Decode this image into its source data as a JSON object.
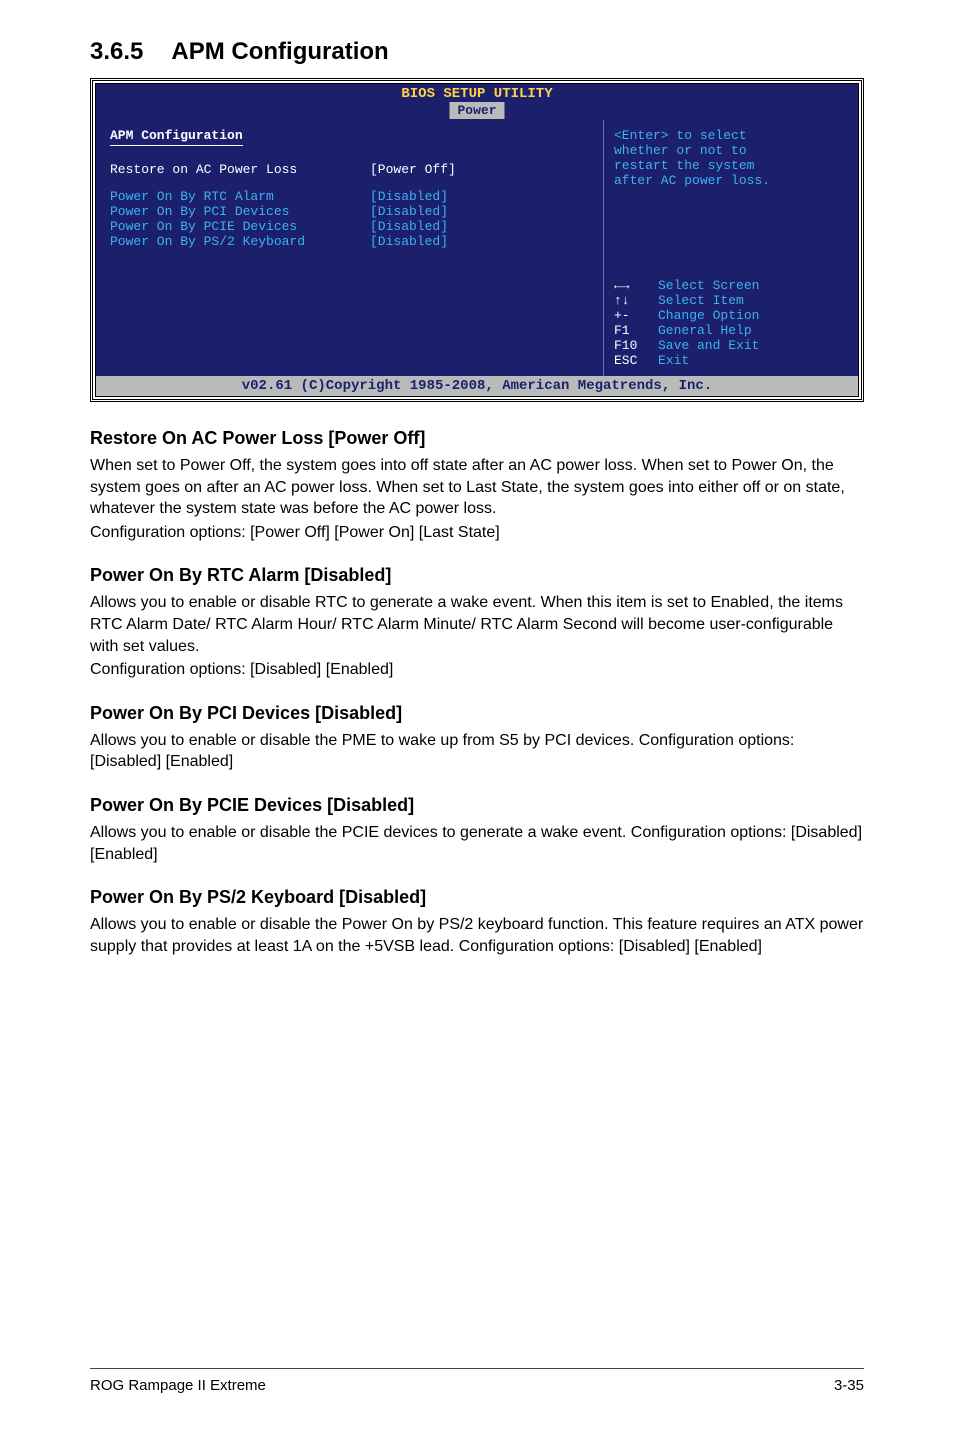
{
  "section": {
    "number": "3.6.5",
    "title": "APM Configuration"
  },
  "bios": {
    "title": "BIOS SETUP UTILITY",
    "tab": "Power",
    "panel_heading": "APM Configuration",
    "items": [
      {
        "label": "Restore on AC Power Loss",
        "value": "[Power Off]"
      },
      {
        "label": "Power On By RTC Alarm",
        "value": "[Disabled]"
      },
      {
        "label": "Power On By PCI Devices",
        "value": "[Disabled]"
      },
      {
        "label": "Power On By PCIE Devices",
        "value": "[Disabled]"
      },
      {
        "label": "Power On By PS/2 Keyboard",
        "value": "[Disabled]"
      }
    ],
    "help1": "<Enter> to select",
    "help2": "whether or not to",
    "help3": "restart the system",
    "help4": "after AC power loss.",
    "nav": [
      {
        "key": "←→",
        "txt": "Select Screen"
      },
      {
        "key": "↑↓",
        "txt": "Select Item"
      },
      {
        "key": "+-",
        "txt": "Change Option"
      },
      {
        "key": "F1",
        "txt": "General Help"
      },
      {
        "key": "F10",
        "txt": "Save and Exit"
      },
      {
        "key": "ESC",
        "txt": "Exit"
      }
    ],
    "footer": "v02.61 (C)Copyright 1985-2008, American Megatrends, Inc."
  },
  "content": {
    "s1h": "Restore On AC Power Loss [Power Off]",
    "s1p": "When set to Power Off, the system goes into off state after an AC power loss. When set to Power On, the system goes on after an AC power loss. When set to Last State, the system goes into either off or on state, whatever the system state was before the AC power loss.",
    "s1c": "Configuration options: [Power Off] [Power On] [Last State]",
    "s2h": "Power On By RTC Alarm [Disabled]",
    "s2p": "Allows you to enable or disable RTC to generate a wake event. When this item is set to Enabled, the items RTC Alarm Date/ RTC Alarm Hour/ RTC Alarm Minute/ RTC Alarm Second will become user-configurable with set values.",
    "s2c": "Configuration options: [Disabled] [Enabled]",
    "s3h": "Power On By PCI Devices [Disabled]",
    "s3p": "Allows you to enable or disable the PME to wake up from S5 by PCI devices. Configuration options: [Disabled] [Enabled]",
    "s4h": "Power On By PCIE Devices [Disabled]",
    "s4p": "Allows you to enable or disable the PCIE devices to generate a wake event. Configuration options: [Disabled] [Enabled]",
    "s5h": "Power On By PS/2 Keyboard [Disabled]",
    "s5p": "Allows you to enable or disable the Power On by PS/2 keyboard function. This feature requires an ATX power supply that provides at least 1A on the +5VSB lead. Configuration options: [Disabled] [Enabled]"
  },
  "footer": {
    "left": "ROG Rampage II Extreme",
    "right": "3-35"
  }
}
